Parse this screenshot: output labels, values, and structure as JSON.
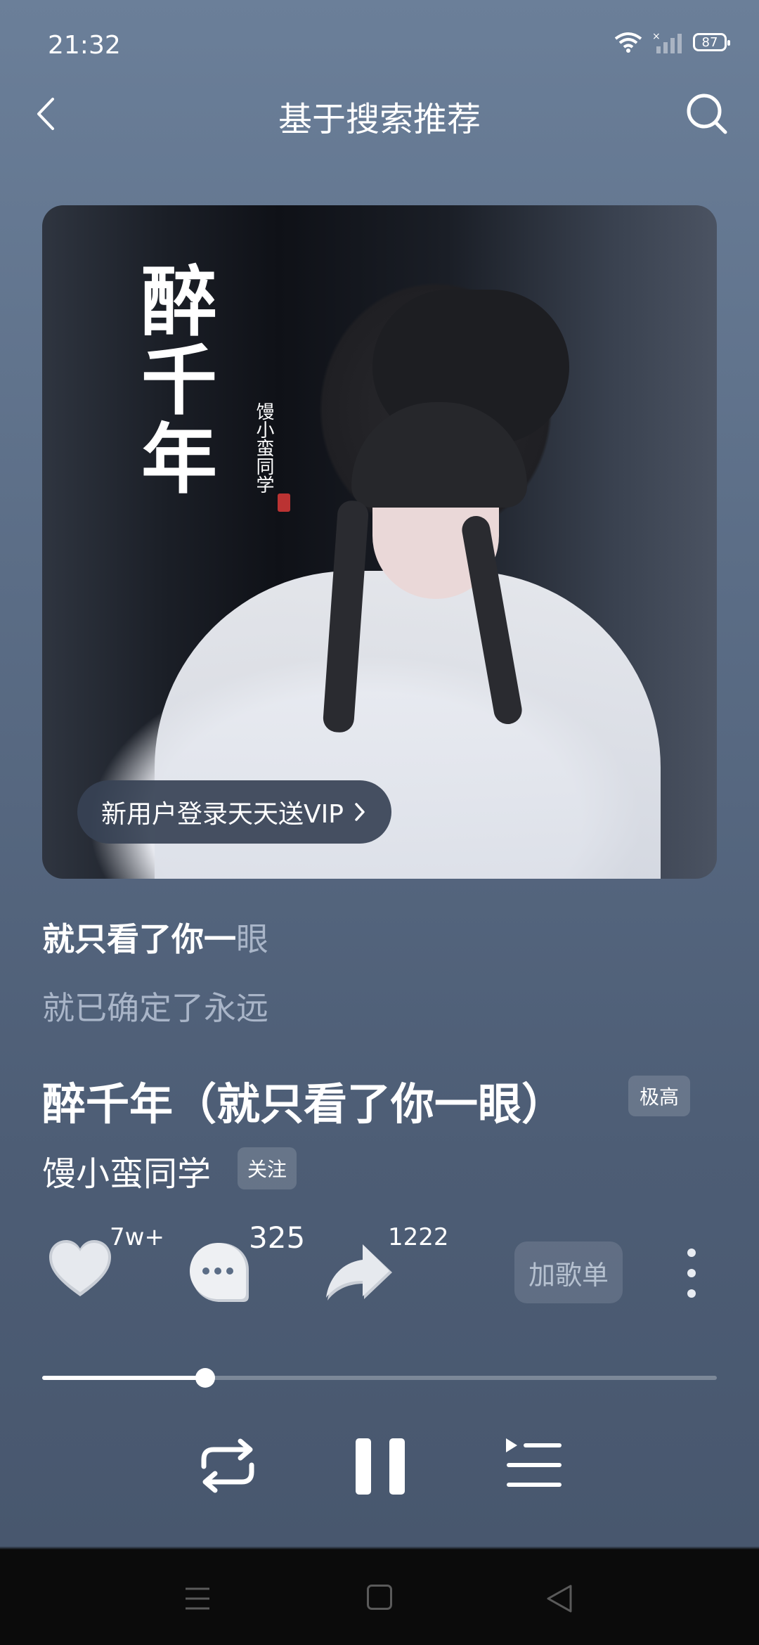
{
  "status_bar": {
    "time": "21:32",
    "battery": "87"
  },
  "header": {
    "title": "基于搜索推荐"
  },
  "album": {
    "cover_title": "醉千年",
    "cover_artist": "馒小蛮同学",
    "vip_banner": "新用户登录天天送VIP"
  },
  "lyrics": {
    "current_sung": "就只看了你一",
    "current_rest": "眼",
    "next": "就已确定了永远"
  },
  "song": {
    "title": "醉千年（就只看了你一眼）",
    "quality": "极高",
    "artist": "馒小蛮同学",
    "follow_label": "关注"
  },
  "actions": {
    "likes": "7w+",
    "comments": "325",
    "shares": "1222",
    "add_playlist": "加歌单"
  },
  "progress": {
    "fraction": 0.242
  },
  "colors": {
    "accent": "#ffffff",
    "background_top": "#6b7f99",
    "background_bottom": "#48576e"
  }
}
